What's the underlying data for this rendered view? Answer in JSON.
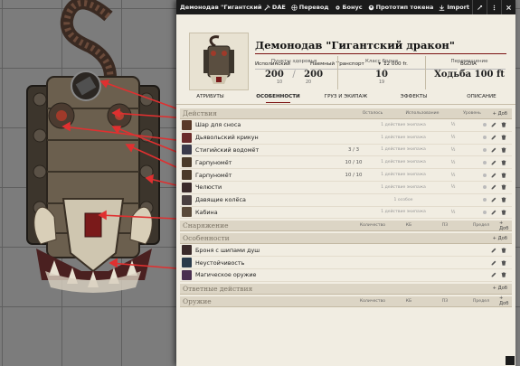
{
  "window": {
    "title": "Демонодав \"Гигантский дракон\"",
    "buttons": {
      "dae": "DAE",
      "translate": "Перевод",
      "bonus": "Бонус",
      "token": "Прототип токена",
      "import": "Import"
    }
  },
  "actor": {
    "name": "Демонодав \"Гигантский дракон\"",
    "fields": {
      "size": "Исполинский",
      "type": "Наемный Транспорт",
      "price": "12 000 fr.",
      "source": "BGDIA"
    },
    "hp": {
      "label": "Пункты здоровья",
      "value": "200",
      "sep": "/",
      "max": "200",
      "temp": "10",
      "tempmax": "20"
    },
    "ac": {
      "label": "Класс брони",
      "value": "10",
      "sub": "19"
    },
    "movement": {
      "label": "Перемещение",
      "value": "Ходьба 100 ft"
    }
  },
  "tabs": [
    "АТРИБУТЫ",
    "ОСОБЕННОСТИ",
    "ГРУЗ И ЭКИПАЖ",
    "ЭФФЕКТЫ",
    "ОПИСАНИЕ"
  ],
  "active_tab": 1,
  "sections": {
    "actions": {
      "title": "Действия",
      "cols": [
        "Осталось",
        "Использование",
        "Уровень"
      ],
      "add": "+ Доб",
      "items": [
        {
          "name": "Шар для сноса",
          "uses": "",
          "action": "1 действие экипажа",
          "reach": "½"
        },
        {
          "name": "Дьявольский крикун",
          "uses": "",
          "action": "1 действие экипажа",
          "reach": "½"
        },
        {
          "name": "Стигийский водомёт",
          "uses": "3 / 3",
          "action": "1 действие экипажа",
          "reach": "½"
        },
        {
          "name": "Гарпуномёт",
          "uses": "10 / 10",
          "action": "1 действие экипажа",
          "reach": "½"
        },
        {
          "name": "Гарпуномёт",
          "uses": "10 / 10",
          "action": "1 действие экипажа",
          "reach": "½"
        },
        {
          "name": "Челюсти",
          "uses": "",
          "action": "1 действие экипажа",
          "reach": "½"
        },
        {
          "name": "Давящие колёса",
          "uses": "",
          "action": "1 особое",
          "reach": ""
        },
        {
          "name": "Кабина",
          "uses": "",
          "action": "1 действие экипажа",
          "reach": "½"
        }
      ]
    },
    "equipment": {
      "title": "Снаряжение",
      "cols": [
        "Количество",
        "КБ",
        "ПЗ",
        "Предел"
      ],
      "add": "+ Доб"
    },
    "features": {
      "title": "Особенности",
      "add": "+ Доб",
      "items": [
        {
          "name": "Броня с шипами душ"
        },
        {
          "name": "Неустойчивость"
        },
        {
          "name": "Магическое оружие"
        }
      ]
    },
    "reactions": {
      "title": "Ответные действия",
      "add": "+ Доб"
    },
    "weapons": {
      "title": "Оружие",
      "cols": [
        "Количество",
        "КБ",
        "ПЗ",
        "Предел"
      ],
      "add": "+ Доб"
    }
  },
  "colors": {
    "accent": "#7a1111",
    "arrow": "#e03030",
    "titlebar": "#1b1b1b",
    "sheet": "#f1ede2"
  },
  "icons": [
    "dae-icon",
    "translate-icon",
    "bonus-icon",
    "token-icon",
    "import-icon",
    "configure-icon",
    "more-icon",
    "close-icon",
    "edit-icon",
    "delete-icon"
  ]
}
